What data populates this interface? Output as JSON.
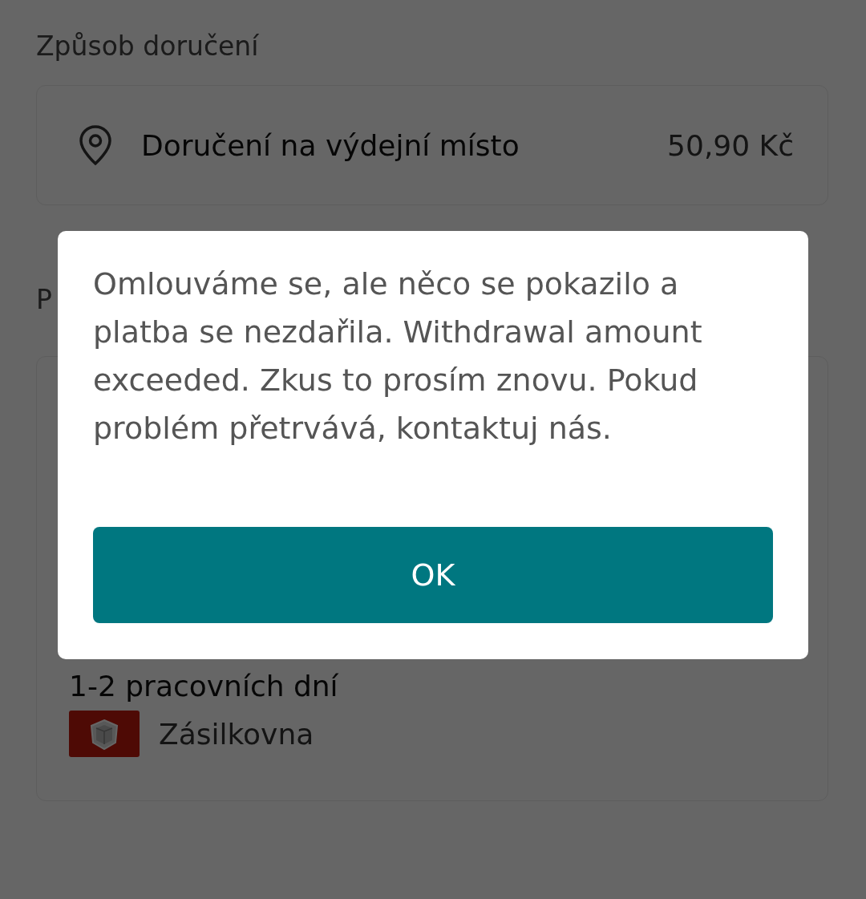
{
  "delivery_section": {
    "heading": "Způsob doručení",
    "option": {
      "label": "Doručení na výdejní místo",
      "price": "50,90 Kč"
    }
  },
  "second_section": {
    "heading": "P",
    "card": {
      "delivery_time": "1-2 pracovních dní",
      "carrier": "Zásilkovna"
    }
  },
  "dialog": {
    "message": "Omlouváme se, ale něco se pokazilo a platba se nezdařila. Withdrawal amount exceeded. Zkus to prosím znovu. Pokud problém přetrvává, kontaktuj nás.",
    "button": "OK"
  }
}
